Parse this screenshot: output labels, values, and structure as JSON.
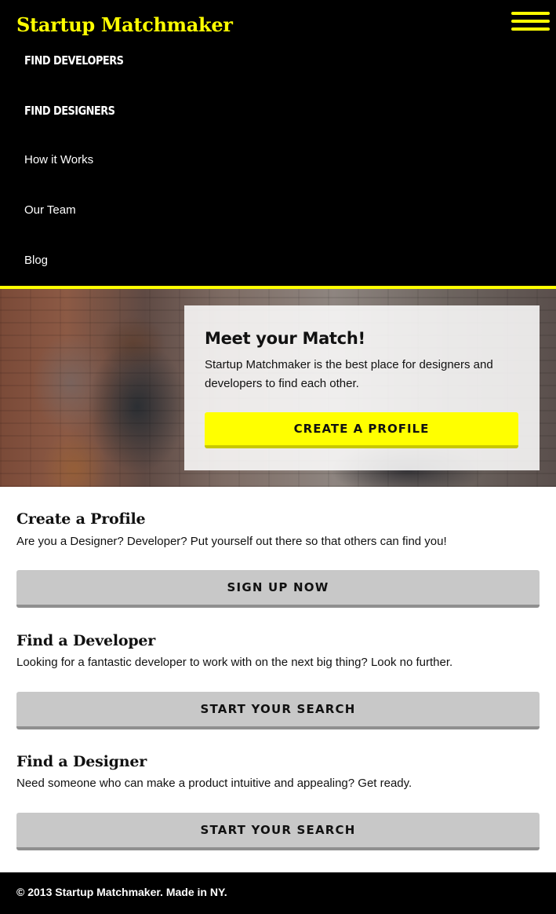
{
  "header": {
    "brand": "Startup Matchmaker",
    "menu_icon": "hamburger-menu-icon"
  },
  "nav": {
    "items": [
      {
        "label": "FIND DEVELOPERS"
      },
      {
        "label": "FIND DESIGNERS"
      },
      {
        "label": "How it Works"
      },
      {
        "label": "Our Team"
      },
      {
        "label": "Blog"
      }
    ]
  },
  "hero": {
    "title": "Meet your Match!",
    "text": "Startup Matchmaker is the best place for designers and developers to find each other.",
    "button": "CREATE A PROFILE"
  },
  "sections": [
    {
      "title": "Create a Profile",
      "text": "Are you a Designer? Developer? Put yourself out there so that others can find you!",
      "button": "SIGN UP NOW"
    },
    {
      "title": "Find a Developer",
      "text": "Looking for a fantastic developer to work with on the next big thing? Look no further.",
      "button": "START YOUR SEARCH"
    },
    {
      "title": "Find a Designer",
      "text": "Need someone who can make a product intuitive and appealing? Get ready.",
      "button": "START YOUR SEARCH"
    }
  ],
  "footer": {
    "text": "© 2013 Startup Matchmaker. Made in NY."
  },
  "colors": {
    "accent": "#ffff00",
    "header_bg": "#000000",
    "button_gray": "#c8c8c8"
  }
}
